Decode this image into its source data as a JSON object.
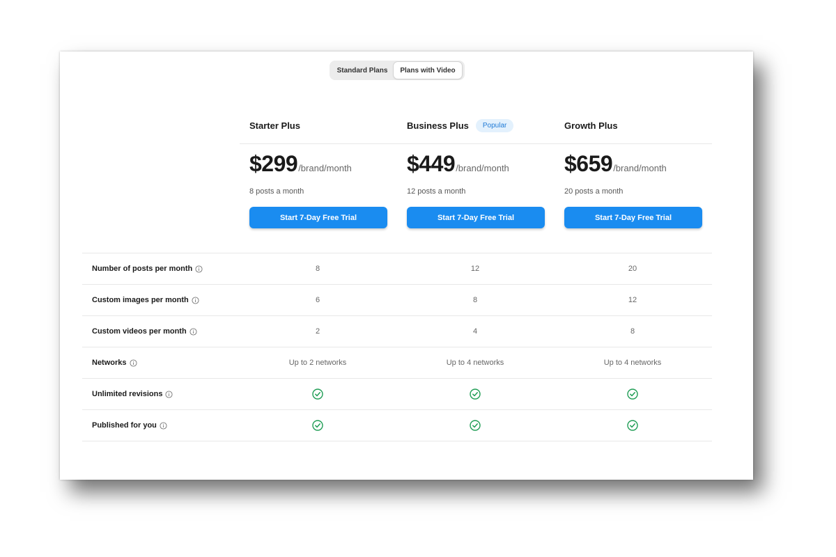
{
  "toggle": {
    "standard_label": "Standard Plans",
    "video_label": "Plans with Video",
    "selected": "Plans with Video"
  },
  "plans": [
    {
      "name": "Starter Plus",
      "badge": "",
      "price": "$299",
      "unit": "/brand/month",
      "posts": "8 posts a month",
      "cta": "Start 7-Day Free Trial"
    },
    {
      "name": "Business Plus",
      "badge": "Popular",
      "price": "$449",
      "unit": "/brand/month",
      "posts": "12 posts a month",
      "cta": "Start 7-Day Free Trial"
    },
    {
      "name": "Growth Plus",
      "badge": "",
      "price": "$659",
      "unit": "/brand/month",
      "posts": "20 posts a month",
      "cta": "Start 7-Day Free Trial"
    }
  ],
  "features": [
    {
      "label": "Number of posts per month",
      "values": [
        "8",
        "12",
        "20"
      ]
    },
    {
      "label": "Custom images per month",
      "values": [
        "6",
        "8",
        "12"
      ]
    },
    {
      "label": "Custom videos per month",
      "values": [
        "2",
        "4",
        "8"
      ]
    },
    {
      "label": "Networks",
      "values": [
        "Up to 2 networks",
        "Up to 4 networks",
        "Up to 4 networks"
      ]
    },
    {
      "label": "Unlimited revisions",
      "values": [
        "check",
        "check",
        "check"
      ]
    },
    {
      "label": "Published for you",
      "values": [
        "check",
        "check",
        "check"
      ]
    }
  ],
  "icons": {
    "info": "info-circle-icon",
    "included": "check-circle-icon"
  },
  "colors": {
    "accent": "#1a8cf0",
    "check": "#1f9d55",
    "badge_bg": "#e3f1fd",
    "badge_text": "#1f7ad6"
  }
}
